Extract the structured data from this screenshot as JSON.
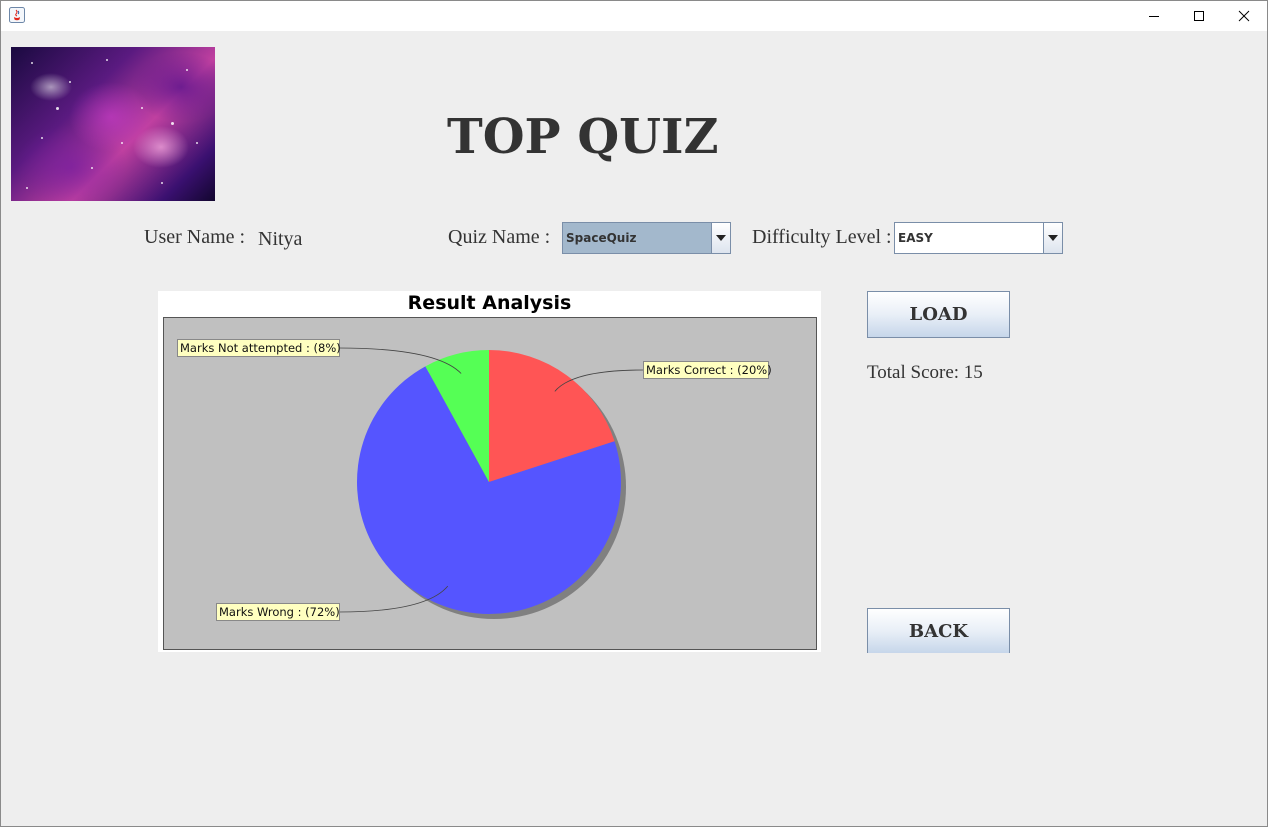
{
  "window": {
    "icon": "java-cup-icon",
    "controls": [
      "minimize-icon",
      "maximize-icon",
      "close-icon"
    ]
  },
  "header": {
    "title": "TOP QUIZ",
    "banner": "galaxy-image"
  },
  "form": {
    "user_label": "User Name :",
    "user_value": "Nitya",
    "quiz_label": "Quiz Name :",
    "quiz_value": "SpaceQuiz",
    "difficulty_label": "Difficulty Level :",
    "difficulty_value": "EASY"
  },
  "actions": {
    "load_label": "LOAD",
    "back_label": "BACK",
    "total_score_text": "Total Score: 15"
  },
  "colors": {
    "background": "#eeeeee",
    "plot_background": "#c0c0c0",
    "label_bg": "#ffffc0",
    "quiz_combo_bg": "#a3b8cc",
    "difficulty_combo_bg": "#ffffff"
  },
  "chart_data": {
    "type": "pie",
    "title": "Result Analysis",
    "slices": [
      {
        "label": "Marks Correct : (20%)",
        "value": 20,
        "color": "#ff5555"
      },
      {
        "label": "Marks Wrong : (72%)",
        "value": 72,
        "color": "#5555ff"
      },
      {
        "label": "Marks Not attempted : (8%)",
        "value": 8,
        "color": "#55ff55"
      }
    ],
    "start": "12 o'clock, clockwise",
    "legend": "none",
    "labels": "callouts outside pie"
  }
}
